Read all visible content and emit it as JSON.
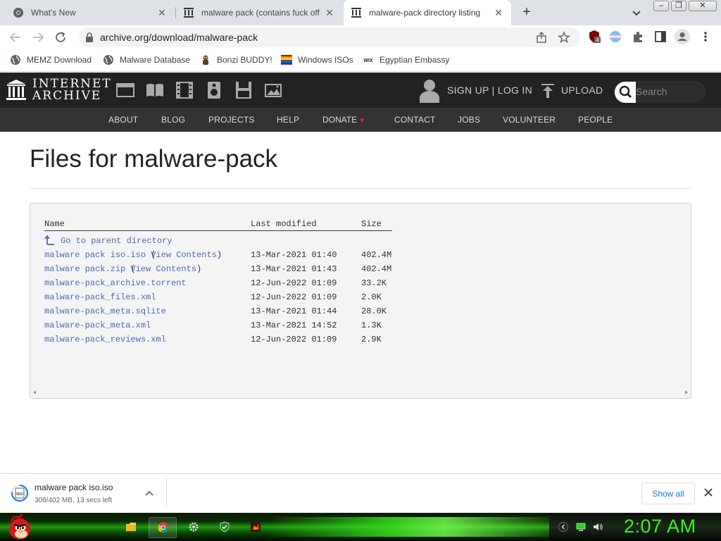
{
  "tabs": [
    {
      "title": "What's New",
      "icon": "chrome-icon",
      "active": false
    },
    {
      "title": "malware pack (contains fuck off (",
      "icon": "archive-icon",
      "active": false
    },
    {
      "title": "malware-pack directory listing",
      "icon": "archive-icon",
      "active": true
    }
  ],
  "window_controls": {
    "minimize": "–",
    "maximize": "❐",
    "close": "✕"
  },
  "toolbar": {
    "url": "archive.org/download/malware-pack",
    "extension_badge": "4"
  },
  "bookmarks": [
    {
      "label": "MEMZ Download",
      "icon": "globe-icon"
    },
    {
      "label": "Malware Database",
      "icon": "globe-icon"
    },
    {
      "label": "Bonzi BUDDY!",
      "icon": "bonzi-icon"
    },
    {
      "label": "Windows ISOs",
      "icon": "windows-flag-icon"
    },
    {
      "label": "Egyptian Embassy",
      "icon": "wix-icon",
      "icon_text": "WIX"
    }
  ],
  "archive_header": {
    "logo_line1": "INTERNET",
    "logo_line2": "ARCHIVE",
    "signup": "SIGN UP | LOG IN",
    "upload": "UPLOAD",
    "search_placeholder": "Search",
    "media_icons": [
      "web-icon",
      "texts-icon",
      "video-icon",
      "audio-icon",
      "software-icon",
      "images-icon"
    ]
  },
  "archive_nav": [
    "ABOUT",
    "BLOG",
    "PROJECTS",
    "HELP",
    "DONATE",
    "CONTACT",
    "JOBS",
    "VOLUNTEER",
    "PEOPLE"
  ],
  "page": {
    "title": "Files for malware-pack"
  },
  "listing": {
    "headers": {
      "name": "Name",
      "modified": "Last modified",
      "size": "Size"
    },
    "parent_link": "Go to parent directory",
    "rows": [
      {
        "name": "malware pack iso.iso",
        "view": "View Contents",
        "modified": "13-Mar-2021 01:40",
        "size": "402.4M"
      },
      {
        "name": "malware pack.zip",
        "view": "View Contents",
        "modified": "13-Mar-2021 01:43",
        "size": "402.4M"
      },
      {
        "name": "malware-pack_archive.torrent",
        "view": "",
        "modified": "12-Jun-2022 01:09",
        "size": "33.2K"
      },
      {
        "name": "malware-pack_files.xml",
        "view": "",
        "modified": "12-Jun-2022 01:09",
        "size": "2.0K"
      },
      {
        "name": "malware-pack_meta.sqlite",
        "view": "",
        "modified": "13-Mar-2021 01:44",
        "size": "28.0K"
      },
      {
        "name": "malware-pack_meta.xml",
        "view": "",
        "modified": "13-Mar-2021 14:52",
        "size": "1.3K"
      },
      {
        "name": "malware-pack_reviews.xml",
        "view": "",
        "modified": "12-Jun-2022 01:09",
        "size": "2.9K"
      }
    ]
  },
  "download_shelf": {
    "filename": "malware pack iso.iso",
    "status": "308/402 MB, 13 secs left",
    "progress": 0.766,
    "icon_text": "ISO",
    "show_all": "Show all"
  },
  "taskbar": {
    "clock": "2:07 AM"
  },
  "colors": {
    "link": "#4a6bb5",
    "archive_bg": "#222222",
    "archive_nav_bg": "#333333",
    "clock": "#3cf020",
    "show_all": "#1a73e8"
  }
}
